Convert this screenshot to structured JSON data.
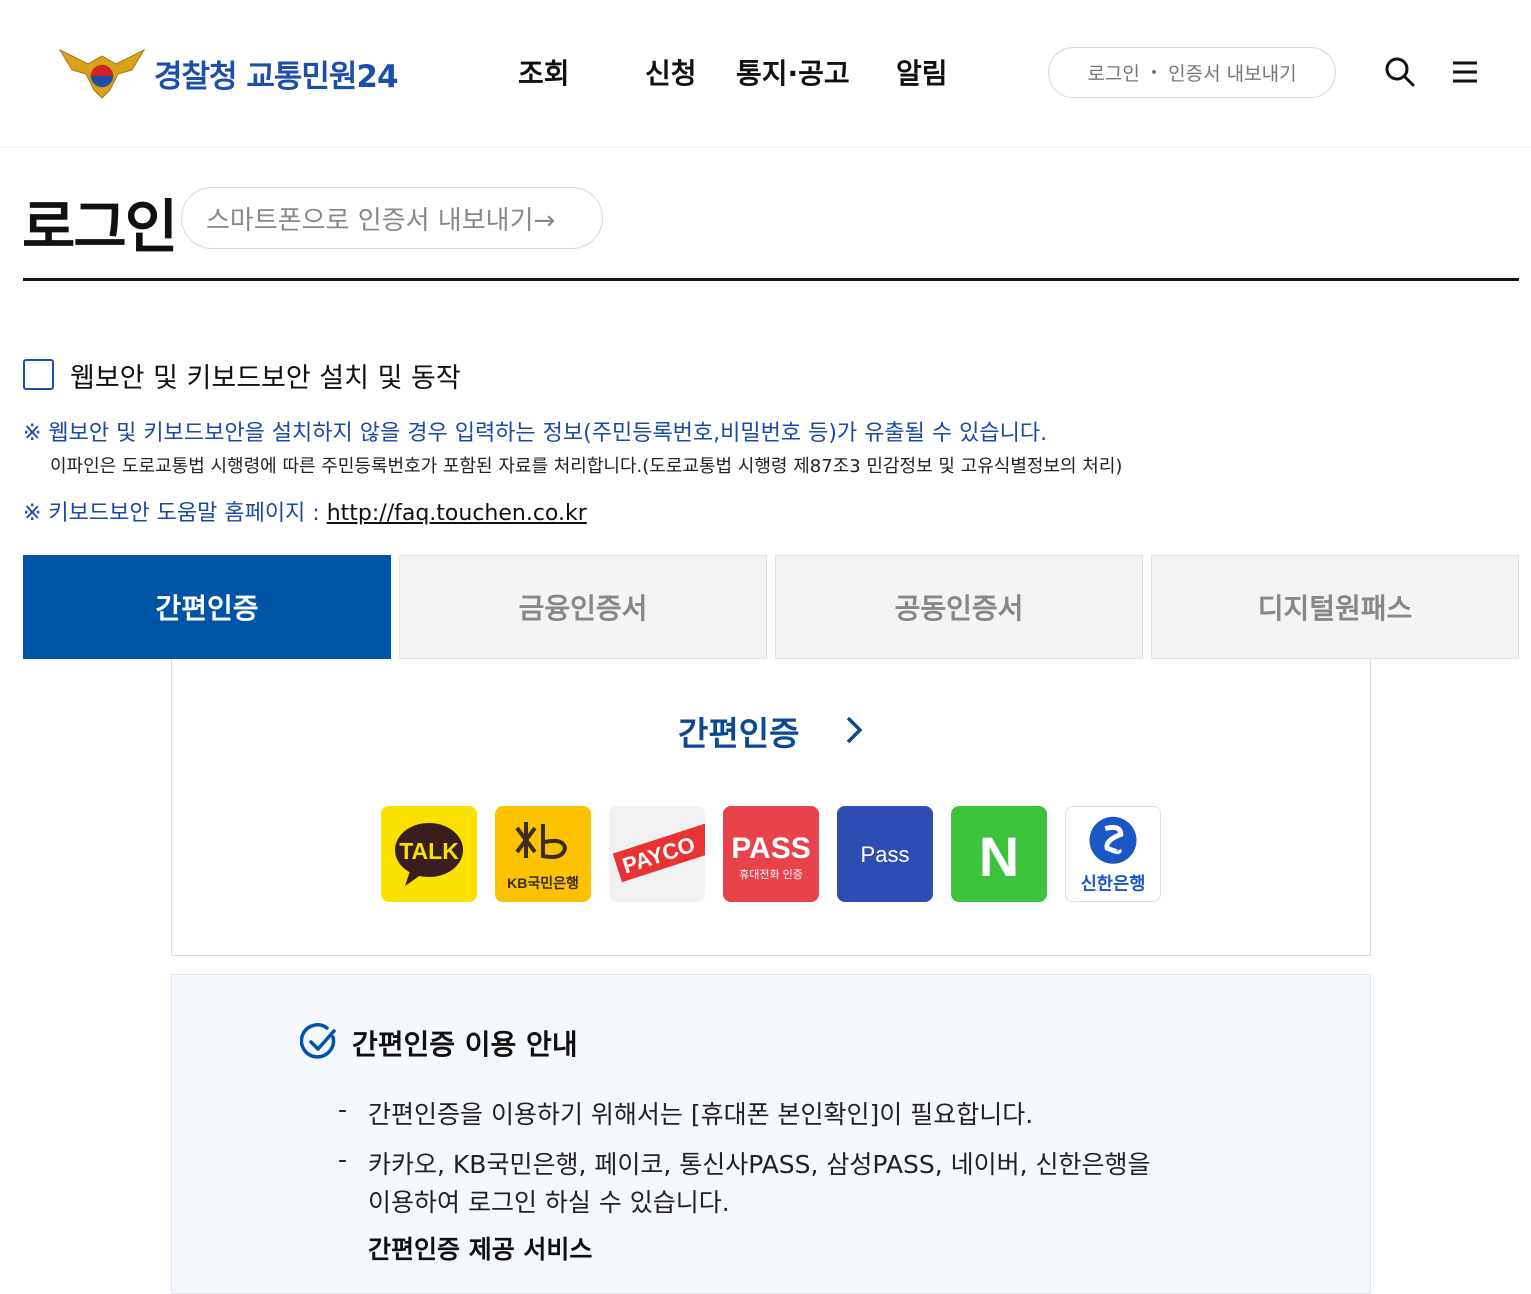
{
  "header": {
    "logo_text": "경찰청 교통민원24",
    "nav": [
      "조회",
      "신청",
      "통지·공고",
      "알림"
    ],
    "login_label": "로그인",
    "cert_export_label": "인증서 내보내기",
    "search_icon": "search-icon",
    "menu_icon": "hamburger-menu-icon"
  },
  "page": {
    "title": "로그인",
    "export_button": "스마트폰으로 인증서 내보내기→"
  },
  "security": {
    "checkbox_label": "웹보안 및 키보드보안 설치 및 동작",
    "checked": false,
    "notice": "※ 웹보안 및 키보드보안을 설치하지 않을 경우 입력하는 정보(주민등록번호,비밀번호 등)가 유출될 수 있습니다.",
    "notice_sub": "이파인은 도로교통법 시행령에 따른 주민등록번호가 포함된 자료를 처리합니다.(도로교통법 시행령 제87조3 민감정보 및 고유식별정보의 처리)",
    "help_prefix": "※ 키보드보안 도움말 홈페이지 : ",
    "help_link": "http://faq.touchen.co.kr"
  },
  "tabs": [
    "간편인증",
    "금융인증서",
    "공동인증서",
    "디지털원패스"
  ],
  "active_tab": 0,
  "simple_auth": {
    "title": "간편인증",
    "providers": [
      {
        "name": "kakao",
        "label": "TALK",
        "bg": "#fae100"
      },
      {
        "name": "kb",
        "label": "KB국민은행",
        "bg": "#fcc200"
      },
      {
        "name": "payco",
        "label": "PAYCO",
        "bg": "#f2f2f2"
      },
      {
        "name": "pass",
        "label": "PASS",
        "sub": "휴대전화 인증",
        "bg": "#e8424a"
      },
      {
        "name": "samsung-pass",
        "label": "Pass",
        "bg": "#2e4db3"
      },
      {
        "name": "naver",
        "label": "N",
        "bg": "#3cc23c"
      },
      {
        "name": "shinhan",
        "label": "신한은행",
        "bg": "#ffffff"
      }
    ]
  },
  "guide": {
    "title": "간편인증 이용 안내",
    "items": [
      "간편인증을 이용하기 위해서는 [휴대폰 본인확인]이 필요합니다.",
      "카카오, KB국민은행, 페이코, 통신사PASS, 삼성PASS, 네이버, 신한은행을",
      "이용하여 로그인 하실 수 있습니다."
    ],
    "sub_title": "간편인증 제공 서비스"
  },
  "colors": {
    "brand_blue": "#0054a6",
    "notice_blue": "#1a4aa3"
  }
}
